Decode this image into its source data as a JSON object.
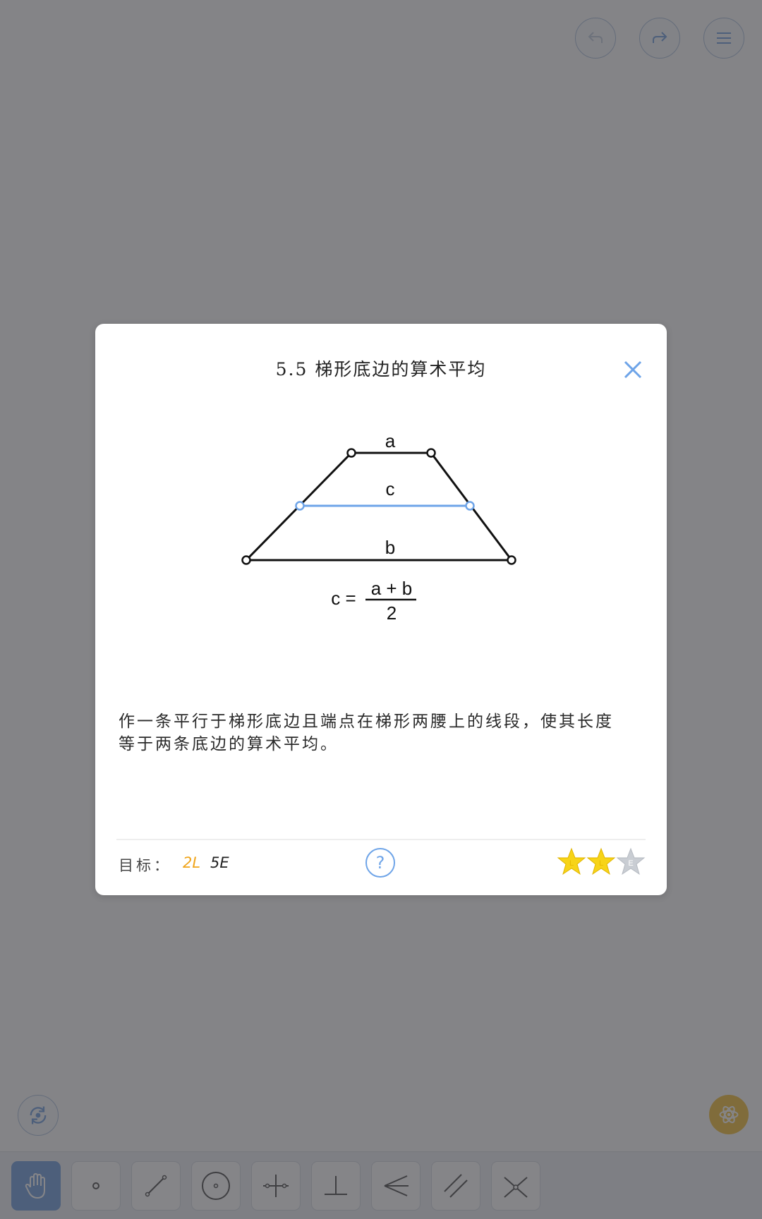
{
  "dialog": {
    "title": "5.5 梯形底边的算术平均",
    "description_line1": "作一条平行于梯形底边且端点在梯形两腰上的线段，使其长度",
    "description_line2": "等于两条底边的算术平均。",
    "goal_label": "目标：",
    "goal_l": "2L",
    "goal_e": "5E",
    "help_label": "?",
    "stars": [
      "L",
      "L",
      "E"
    ]
  },
  "figure": {
    "label_a": "a",
    "label_b": "b",
    "label_c": "c",
    "formula_lhs": "c =",
    "formula_num": "a + b",
    "formula_den": "2"
  },
  "colors": {
    "accent": "#6ea4e8",
    "star_gold": "#f7d417",
    "star_grey": "#c9cdd3",
    "goal_l": "#f0a51c"
  },
  "icons": {
    "undo": "undo-arrow-icon",
    "redo": "redo-arrow-icon",
    "menu": "hamburger-menu-icon",
    "close": "close-x-icon",
    "reset": "rotate-reset-icon",
    "hint": "atom-hint-icon",
    "tools": [
      "hand-move-icon",
      "point-icon",
      "line-icon",
      "circle-icon",
      "perpendicular-bisector-icon",
      "perpendicular-icon",
      "angle-bisector-icon",
      "parallel-line-icon",
      "intersection-icon"
    ]
  }
}
